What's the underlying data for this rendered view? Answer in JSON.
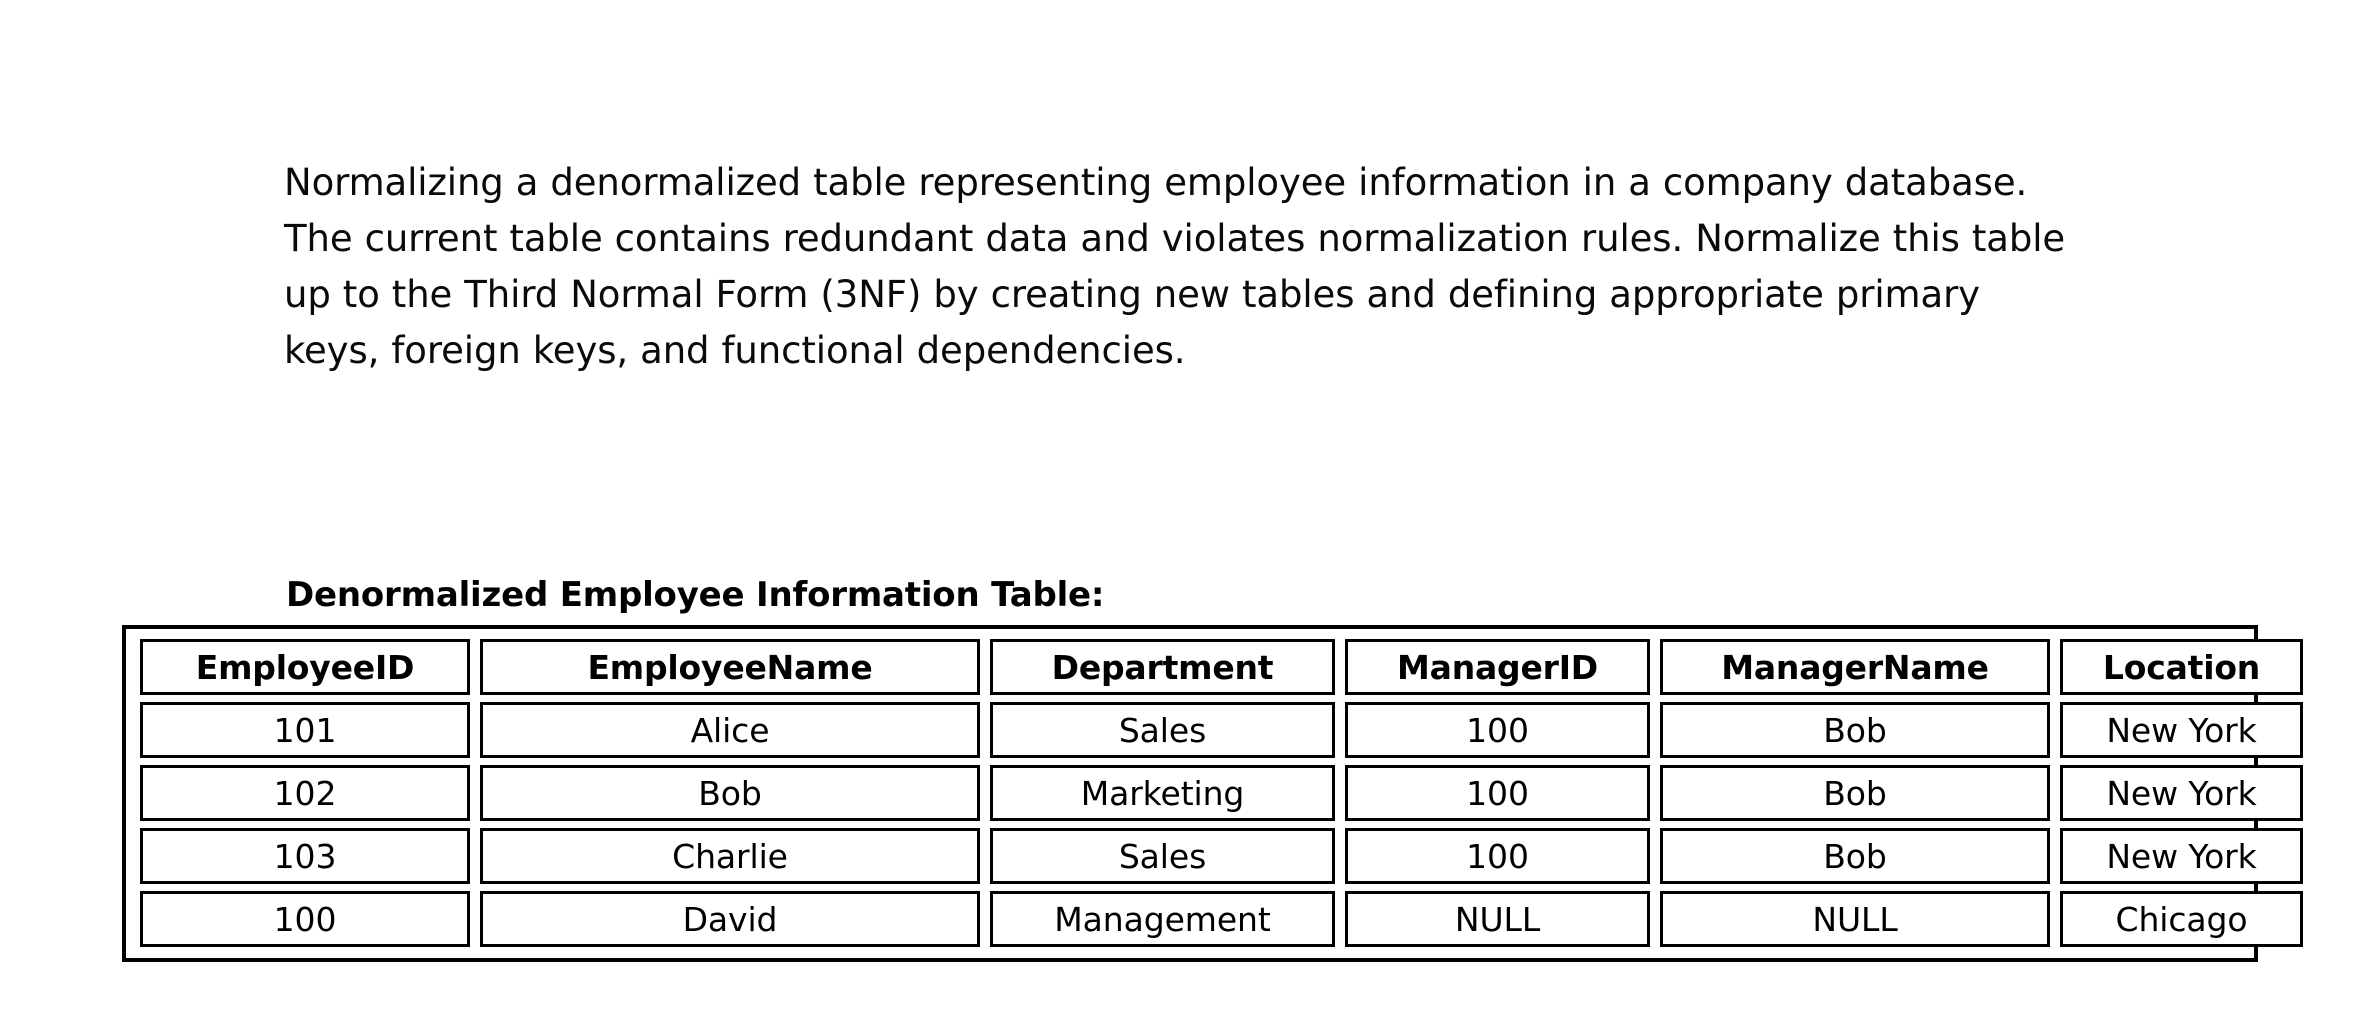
{
  "document": {
    "intro_paragraph": "Normalizing a denormalized table representing employee information in a company database. The current table contains redundant data and violates normalization rules. Normalize this table up to the Third Normal Form (3NF) by creating new tables and defining appropriate primary keys, foreign keys, and functional dependencies."
  },
  "table": {
    "caption": "Denormalized Employee Information Table:",
    "columns": [
      "EmployeeID",
      "EmployeeName",
      "Department",
      "ManagerID",
      "ManagerName",
      "Location"
    ],
    "rows": [
      {
        "EmployeeID": "101",
        "EmployeeName": "Alice",
        "Department": "Sales",
        "ManagerID": "100",
        "ManagerName": "Bob",
        "Location": "New York"
      },
      {
        "EmployeeID": "102",
        "EmployeeName": "Bob",
        "Department": "Marketing",
        "ManagerID": "100",
        "ManagerName": "Bob",
        "Location": "New York"
      },
      {
        "EmployeeID": "103",
        "EmployeeName": "Charlie",
        "Department": "Sales",
        "ManagerID": "100",
        "ManagerName": "Bob",
        "Location": "New York"
      },
      {
        "EmployeeID": "100",
        "EmployeeName": "David",
        "Department": "Management",
        "ManagerID": "NULL",
        "ManagerName": "NULL",
        "Location": "Chicago"
      }
    ]
  },
  "colors": {
    "text": "#000000",
    "background": "#ffffff",
    "border": "#000000"
  }
}
